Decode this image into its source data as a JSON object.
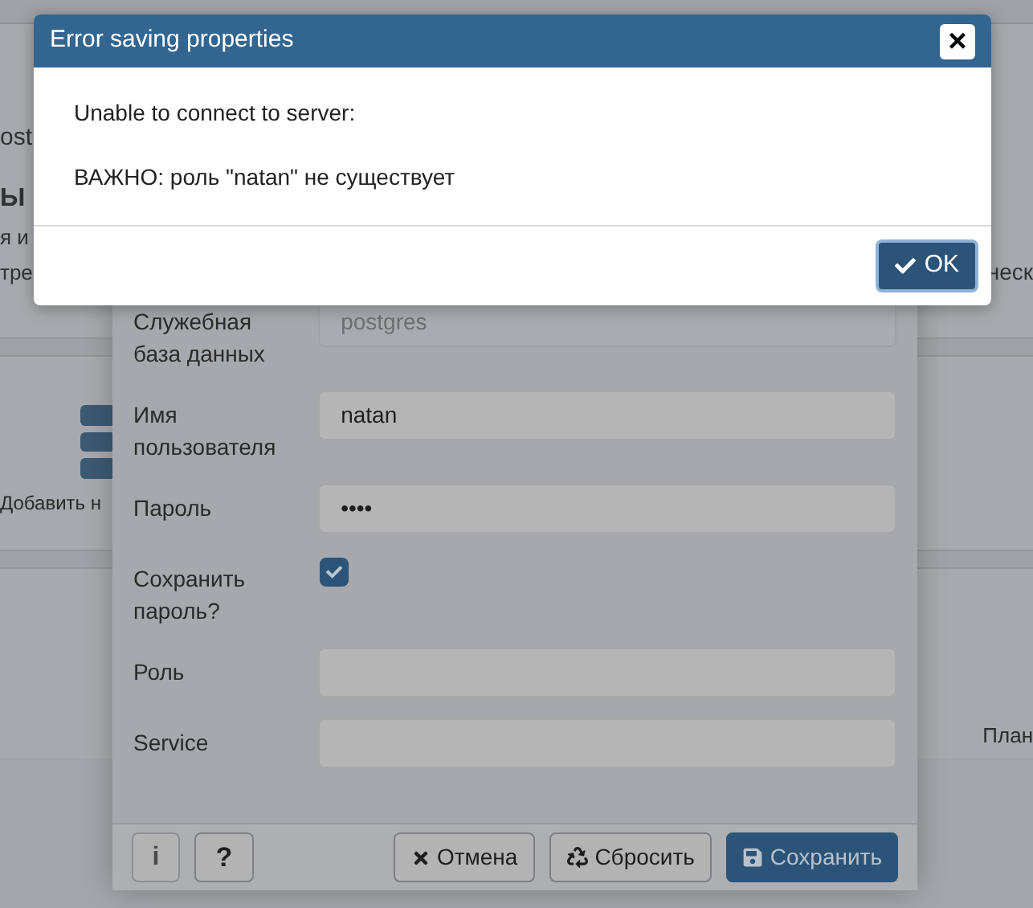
{
  "background": {
    "title_fragment": "ost",
    "heading_fragment": "Ы",
    "line_fragments": [
      "я и",
      "тре"
    ],
    "right_fragment": "неск",
    "add_button_fragment": "Добавить н",
    "right_label_fragment": "План"
  },
  "properties_dialog": {
    "fields": [
      {
        "kind": "text",
        "label": "Служебная база данных",
        "value": "postgres",
        "disabled": true
      },
      {
        "kind": "text",
        "label": "Имя пользователя",
        "value": "natan"
      },
      {
        "kind": "password",
        "label": "Пароль",
        "value": "••••"
      },
      {
        "kind": "checkbox",
        "label": "Сохранить пароль?",
        "checked": true
      },
      {
        "kind": "text",
        "label": "Роль"
      },
      {
        "kind": "text",
        "label": "Service"
      }
    ],
    "footer": {
      "info": "i",
      "help": "?",
      "buttons": [
        {
          "kind": "cancel",
          "label": "Отмена"
        },
        {
          "kind": "reset",
          "label": "Сбросить"
        },
        {
          "kind": "save",
          "label": "Сохранить"
        }
      ]
    }
  },
  "error_dialog": {
    "title": "Error saving properties",
    "close": "×",
    "messages": [
      "Unable to connect to server:",
      "ВАЖНО: роль \"natan\" не существует"
    ],
    "ok_button": "OK"
  }
}
